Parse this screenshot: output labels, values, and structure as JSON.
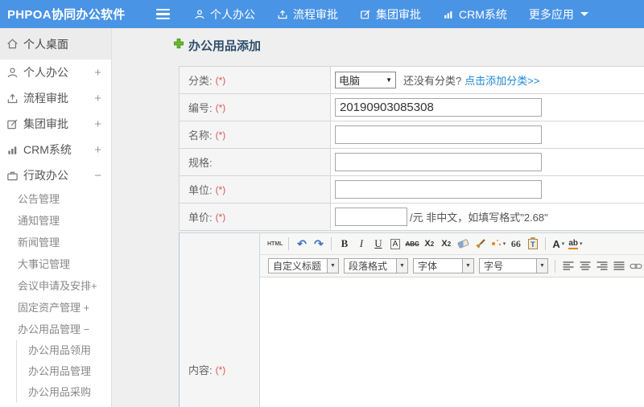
{
  "colors": {
    "topbar": "#4a94e5",
    "link": "#1e88d2",
    "required": "#e05555",
    "title_text": "#2f4f6b",
    "add_icon_green": "#67b92e"
  },
  "header": {
    "logo": "PHPOA协同办公软件",
    "nav": [
      {
        "label": "个人办公",
        "icon": "person-icon"
      },
      {
        "label": "流程审批",
        "icon": "flow-icon"
      },
      {
        "label": "集团审批",
        "icon": "edit-icon"
      },
      {
        "label": "CRM系统",
        "icon": "chart-icon"
      },
      {
        "label": "更多应用",
        "icon": "caret-down-icon"
      }
    ]
  },
  "sidebar": {
    "items": [
      {
        "label": "个人桌面",
        "icon": "home-icon",
        "expander": ""
      },
      {
        "label": "个人办公",
        "icon": "person-icon",
        "expander": "+"
      },
      {
        "label": "流程审批",
        "icon": "flow-icon",
        "expander": "+"
      },
      {
        "label": "集团审批",
        "icon": "edit-icon",
        "expander": "+"
      },
      {
        "label": "CRM系统",
        "icon": "chart-icon",
        "expander": "+"
      },
      {
        "label": "行政办公",
        "icon": "briefcase-icon",
        "expander": "−"
      }
    ],
    "admin_children": [
      "公告管理",
      "通知管理",
      "新闻管理",
      "大事记管理",
      "会议申请及安排+",
      "固定资产管理 +",
      "办公用品管理 −"
    ],
    "supplies_children": [
      "办公用品领用",
      "办公用品管理",
      "办公用品采购"
    ]
  },
  "form": {
    "title": "办公用品添加",
    "category": {
      "label": "分类:",
      "required": "(*)",
      "selected": "电脑",
      "hint": "还没有分类?",
      "add_link": "点击添加分类>>"
    },
    "code": {
      "label": "编号:",
      "required": "(*)",
      "value": "20190903085308"
    },
    "name": {
      "label": "名称:",
      "required": "(*)",
      "value": ""
    },
    "spec": {
      "label": "规格:",
      "value": ""
    },
    "unit": {
      "label": "单位:",
      "required": "(*)",
      "value": ""
    },
    "price": {
      "label": "单价:",
      "required": "(*)",
      "value": "",
      "suffix": "/元 非中文，如填写格式\"2.68\""
    },
    "content": {
      "label": "内容:",
      "required": "(*)"
    }
  },
  "editor": {
    "source_label": "HTML",
    "undo_glyph": "↶",
    "redo_glyph": "↷",
    "bold": "B",
    "italic": "I",
    "underline": "U",
    "font_box": "A",
    "strikethrough": "ABC",
    "sup_base": "X",
    "sub_base": "X",
    "blockquote": "66",
    "paste_letter": "T",
    "font_color": "A",
    "highlight": "ab",
    "combos": [
      "自定义标题",
      "段落格式",
      "字体",
      "字号"
    ],
    "icon_names_row1": [
      "html-source-icon",
      "undo-icon",
      "redo-icon",
      "bold-icon",
      "italic-icon",
      "underline-icon",
      "font-box-icon",
      "strikethrough-icon",
      "superscript-icon",
      "subscript-icon",
      "eraser-icon",
      "format-brush-icon",
      "auto-typeset-icon",
      "blockquote-icon",
      "paste-text-icon",
      "font-color-icon",
      "highlight-color-icon"
    ],
    "icon_names_row2": [
      "align-left-icon",
      "align-center-icon",
      "align-right-icon",
      "justify-icon",
      "link-icon"
    ]
  }
}
